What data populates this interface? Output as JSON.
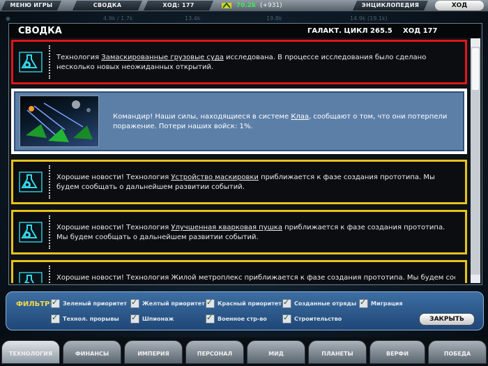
{
  "top_menu": {
    "game_menu": "МЕНЮ ИГРЫ",
    "summary": "СВОДКА",
    "turn": "ХОД: 177",
    "credits": "70.2k",
    "credits_delta": "(+931)",
    "encyclopedia": "ЭНЦИКЛОПЕДИЯ",
    "end_turn": "ХОД"
  },
  "background_stats": [
    "4.9k / 1.7k",
    "13.4k",
    "19.8k",
    "14.9k (19.1k)"
  ],
  "panel": {
    "title": "СВОДКА",
    "galactic_cycle": "ГАЛАКТ. ЦИКЛ 265.5",
    "turn": "ХОД 177"
  },
  "messages": [
    {
      "kind": "red",
      "icon": "research-flask-gear-icon",
      "pre": "Технология ",
      "link": "Замаскированные грузовые суда",
      "post": " исследована. В процессе исследования было сделано несколько новых неожиданных открытий."
    },
    {
      "kind": "blue",
      "icon": "battle-scene-image",
      "pre": "Командир! Наши силы, находящиеся в системе ",
      "link": "Клаа",
      "post": ", сообщают о том, что они потерпели поражение. Потери наших войск: 1%."
    },
    {
      "kind": "yellow",
      "icon": "research-flask-gear-icon",
      "pre": "Хорошие новости! Технология ",
      "link": "Устройство маскировки",
      "post": " приближается к фазе создания прототипа. Мы будем сообщать о дальнейшем развитии событий."
    },
    {
      "kind": "yellow",
      "icon": "research-flask-gear-icon",
      "pre": "Хорошие новости! Технология ",
      "link": "Улучшенная кварковая пушка",
      "post": " приближается к фазе создания прототипа. Мы будем сообщать о дальнейшем развитии событий."
    },
    {
      "kind": "yellow",
      "icon": "research-flask-gear-icon",
      "pre": "Хорошие новости! Технология Жилой метроплекс приближается к фазе создания прототипа. Мы будем сообщать",
      "link": "",
      "post": ""
    }
  ],
  "filter": {
    "label": "ФИЛЬТР:",
    "options": [
      {
        "label": "Зеленый приоритет",
        "checked": true
      },
      {
        "label": "Желтый приоритет",
        "checked": true
      },
      {
        "label": "Красный приоритет",
        "checked": true
      },
      {
        "label": "Созданные отряды",
        "checked": true
      },
      {
        "label": "Миграция",
        "checked": true
      },
      {
        "label": "Технол. прорывы",
        "checked": true
      },
      {
        "label": "Шпионаж",
        "checked": true
      },
      {
        "label": "Военное стр-во",
        "checked": true
      },
      {
        "label": "Строительство",
        "checked": true
      }
    ],
    "close": "ЗАКРЫТЬ"
  },
  "tabs": [
    "ТЕХНОЛОГИЯ",
    "ФИНАНСЫ",
    "ИМПЕРИЯ",
    "ПЕРСОНАЛ",
    "МИД",
    "ПЛАНЕТЫ",
    "ВЕРФИ",
    "ПОБЕДА"
  ],
  "colors": {
    "message_red": "#e0161a",
    "message_yellow": "#e8c21e",
    "message_blue": "#5c7fa8",
    "credits_green": "#3fe85c",
    "filter_label": "#f3d84a"
  }
}
